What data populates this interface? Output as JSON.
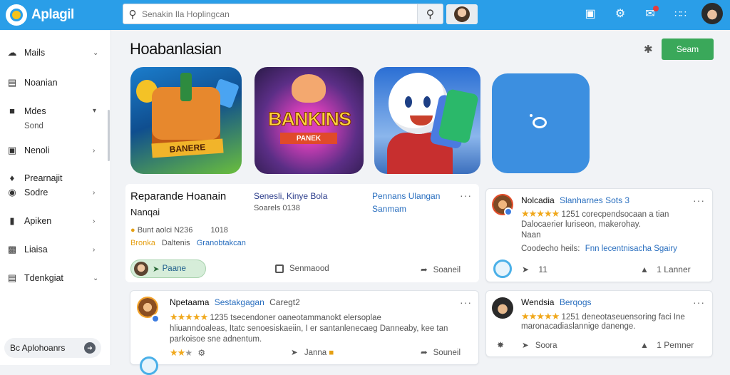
{
  "brand": {
    "name": "Aplagil"
  },
  "search": {
    "placeholder": "Senakin Ila Hoplingcan"
  },
  "sidebar": {
    "items": [
      {
        "label": "Mails",
        "icon": "cloud-icon"
      },
      {
        "label": "Noanian",
        "icon": "list-icon"
      },
      {
        "label": "Mdes",
        "sub": "Sond",
        "icon": "folder-icon"
      },
      {
        "label": "Nenoli",
        "icon": "box-icon"
      },
      {
        "label": "Prearnajit",
        "sub": "Sodre",
        "icon": "pin-icon"
      },
      {
        "label": "Apiken",
        "icon": "tag-icon"
      },
      {
        "label": "Liaisa",
        "icon": "chart-icon"
      },
      {
        "label": "Tdenkgiat",
        "icon": "graph-icon"
      }
    ],
    "bottom_label": "Bc Aplohoanrs"
  },
  "main": {
    "title": "Hoabanlasian",
    "action_button": "Seam"
  },
  "tiles": [
    {
      "label": "BANERE"
    },
    {
      "label": "BANKINS",
      "sub": "PANEK"
    },
    {
      "label": ""
    },
    {
      "label": ""
    }
  ],
  "games": [
    {
      "title": "Reparande Hoanain",
      "subtitle": "Nanqai",
      "meta1": "Bunt aolci",
      "meta1_num": "N236",
      "meta1_num2": "1018",
      "meta2_a": "Bronka",
      "meta2_b": "Daltenis",
      "meta2_c": "Granobtakcan"
    },
    {
      "title": "Senesli, Kinye Bola",
      "subtitle": "Soarels 0138"
    },
    {
      "title": "Pennans Ulangan",
      "subtitle": "Sanmam"
    }
  ],
  "featured_actions": {
    "chip": "Paane",
    "mid": "Senmaood",
    "right": "Soaneil"
  },
  "reviews": [
    {
      "name": "Nolcadia",
      "tag": "Slanharnes Sots 3",
      "rating": "1251",
      "text1": "corecpendsocaan a tian",
      "text2": "Dalocaerier luriseon, makerohay.",
      "text3": "Naan",
      "foot_a": "Coodecho heils:",
      "foot_b": "Fnn lecentnisacha Sgairy",
      "actions": {
        "left": "11",
        "right_num": "1",
        "right": "Lanner"
      }
    },
    {
      "name": "Npetaama",
      "tag": "Sestakgagan",
      "tag2": "Caregt2",
      "rating": "1235",
      "text1": "tsecendoner oaneotammanokt elersoplae",
      "text2": "hliuanndoaleas, Itatc senoesiskaeiin, I er santanlenecaeg Danneaby, kee tan",
      "text3": "parkoisoe sne adnentum.",
      "actions": {
        "left": "",
        "mid": "Janna",
        "right": "Souneil"
      }
    },
    {
      "name": "Wendsia",
      "tag": "Berqogs",
      "rating": "1251",
      "text1": "deneotaseuensoring faci Ine",
      "text2": "maronacadiaslannige danenge.",
      "actions": {
        "left": "Soora",
        "right_num": "1",
        "right": "Pemner"
      }
    }
  ]
}
